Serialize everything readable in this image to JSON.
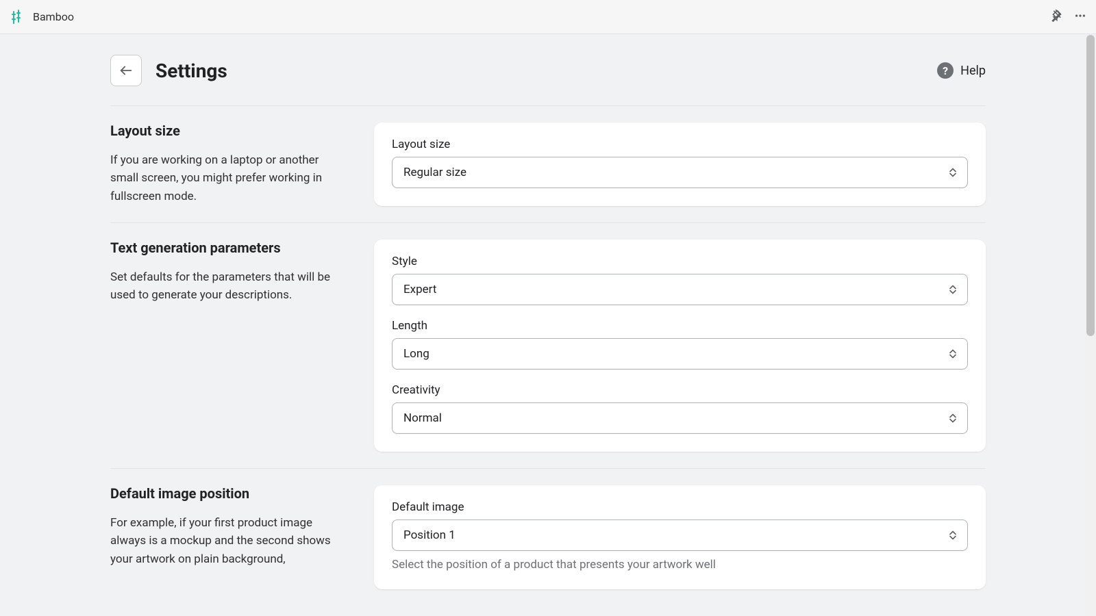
{
  "topbar": {
    "app_name": "Bamboo"
  },
  "header": {
    "title": "Settings",
    "help_label": "Help"
  },
  "sections": {
    "layout_size": {
      "title": "Layout size",
      "desc": "If you are working on a laptop or another small screen, you might prefer working in fullscreen mode.",
      "fields": {
        "layout_size": {
          "label": "Layout size",
          "value": "Regular size"
        }
      }
    },
    "text_gen": {
      "title": "Text generation parameters",
      "desc": "Set defaults for the parameters that will be used to generate your descriptions.",
      "fields": {
        "style": {
          "label": "Style",
          "value": "Expert"
        },
        "length": {
          "label": "Length",
          "value": "Long"
        },
        "creativity": {
          "label": "Creativity",
          "value": "Normal"
        }
      }
    },
    "default_image": {
      "title": "Default image position",
      "desc": "For example, if your first product image always is a mockup and the second shows your artwork on plain background,",
      "fields": {
        "default_image": {
          "label": "Default image",
          "value": "Position 1",
          "help": "Select the position of a product that presents your artwork well"
        }
      }
    }
  }
}
